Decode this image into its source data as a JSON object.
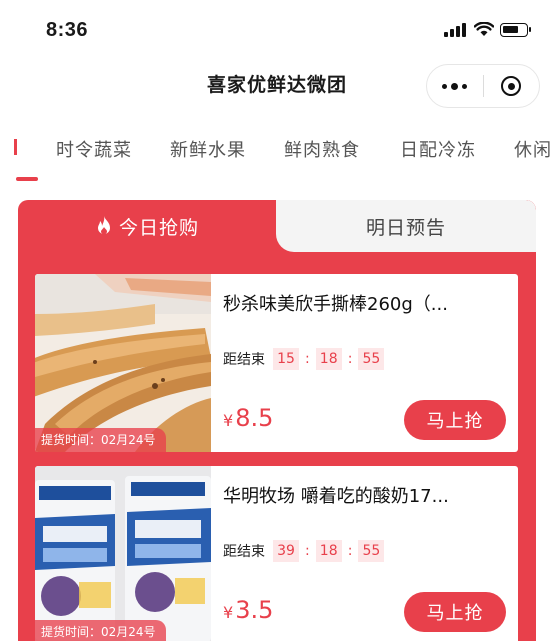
{
  "status_bar": {
    "time": "8:36"
  },
  "nav": {
    "title": "喜家优鲜达微团"
  },
  "categories": {
    "partial_left": "",
    "items": [
      "时令蔬菜",
      "新鲜水果",
      "鲜肉熟食",
      "日配冷冻",
      "休闲"
    ]
  },
  "tabs": {
    "today": "今日抢购",
    "tomorrow": "明日预告"
  },
  "products": [
    {
      "title": "秒杀味美欣手撕棒260g（...",
      "countdown_label": "距结束",
      "hours": "15",
      "minutes": "18",
      "seconds": "55",
      "currency": "¥",
      "price": "8.5",
      "button": "马上抢",
      "pickup": "提货时间：02月24号"
    },
    {
      "title": "华明牧场 嚼着吃的酸奶17...",
      "countdown_label": "距结束",
      "hours": "39",
      "minutes": "18",
      "seconds": "55",
      "currency": "¥",
      "price": "3.5",
      "button": "马上抢",
      "pickup": "提货时间：02月24号"
    }
  ],
  "colors": {
    "accent": "#e8404b",
    "tab_inactive_bg": "#f4f4f4",
    "countdown_bg": "#fde7e8"
  },
  "icons": {
    "signal": "signal-icon",
    "wifi": "wifi-icon",
    "battery": "battery-icon",
    "more": "more-dots-icon",
    "close_target": "target-icon",
    "fire": "fire-icon"
  }
}
